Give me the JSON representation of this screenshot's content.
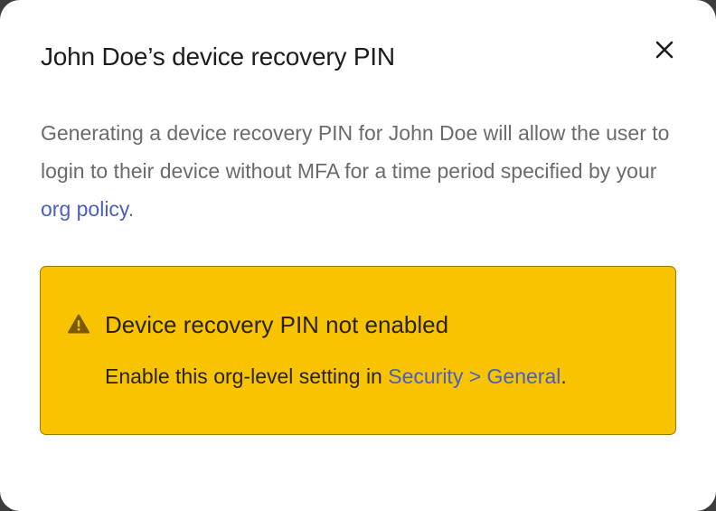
{
  "modal": {
    "title": "John Doe’s device recovery PIN",
    "close_icon": "close-icon",
    "description_text": "Generating a device recovery PIN for John Doe will allow the user to login to their device without MFA for a time period specified by your ",
    "description_link": "org policy",
    "description_end": "."
  },
  "warning": {
    "icon": "warning-icon",
    "title": "Device recovery PIN not enabled",
    "text": "Enable this org-level setting in ",
    "link": "Security > General",
    "text_end": ".",
    "background_color": "#f8c300",
    "icon_color": "#7a5a00"
  },
  "colors": {
    "link": "#4a5fc1",
    "body_text": "#6b6b6b",
    "title_text": "#1d1d1f"
  }
}
